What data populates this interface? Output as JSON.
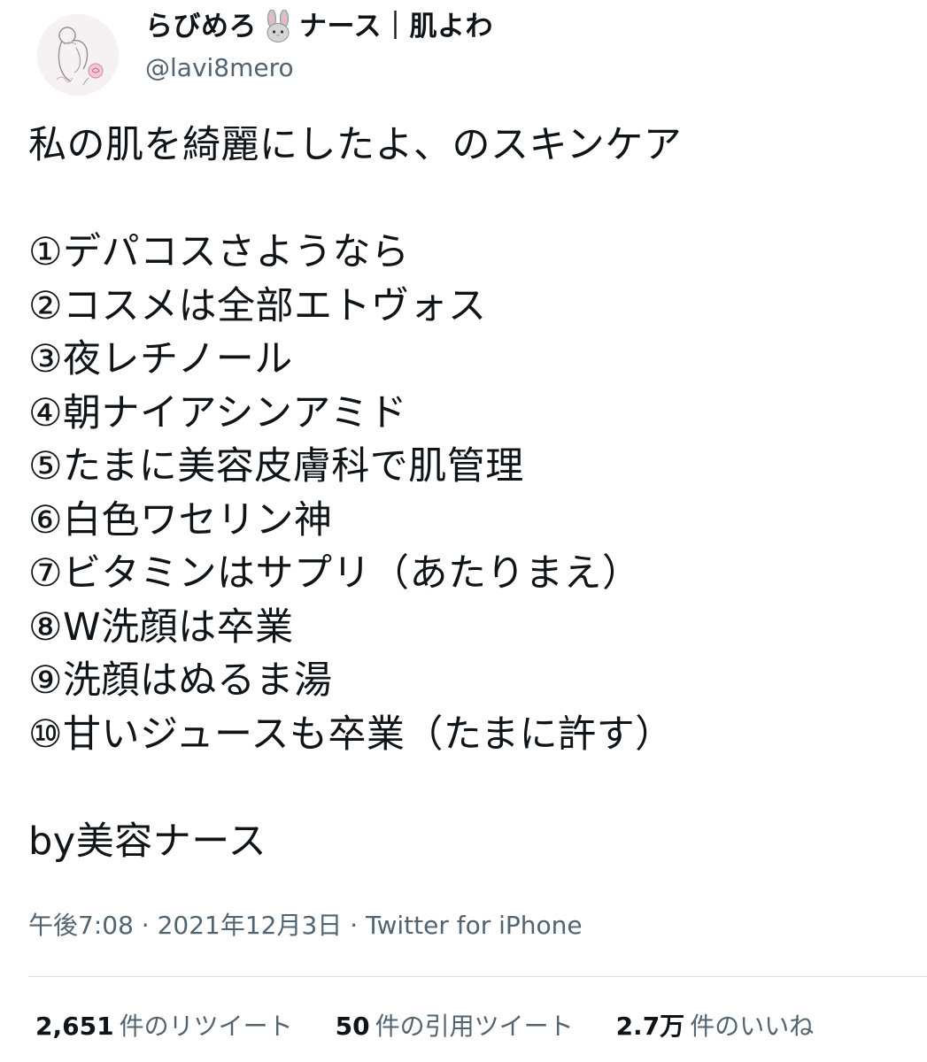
{
  "user": {
    "name_part1": "らびめろ",
    "name_part2": "ナース｜肌よわ",
    "handle": "@lavi8mero",
    "name_emoji_icon": "rabbit-face-icon",
    "avatar_icon": "illustrated-woman-with-rose-avatar"
  },
  "tweet": {
    "lines": [
      "私の肌を綺麗にしたよ、のスキンケア",
      "",
      "①デパコスさようなら",
      "②コスメは全部エトヴォス",
      "③夜レチノール",
      "④朝ナイアシンアミド",
      "⑤たまに美容皮膚科で肌管理",
      "⑥白色ワセリン神",
      "⑦ビタミンはサプリ（あたりまえ）",
      "⑧W洗顔は卒業",
      "⑨洗顔はぬるま湯",
      "⑩甘いジュースも卒業（たまに許す）",
      "",
      "by美容ナース"
    ]
  },
  "meta": {
    "time": "午後7:08",
    "separator": " · ",
    "date": "2021年12月3日",
    "source": "Twitter for iPhone"
  },
  "stats": {
    "retweets_count": "2,651",
    "retweets_label": "件のリツイート",
    "quotes_count": "50",
    "quotes_label": "件の引用ツイート",
    "likes_count": "2.7万",
    "likes_label": "件のいいね"
  },
  "colors": {
    "text": "#0f1419",
    "secondary": "#536471",
    "divider": "#dfe3e6"
  }
}
